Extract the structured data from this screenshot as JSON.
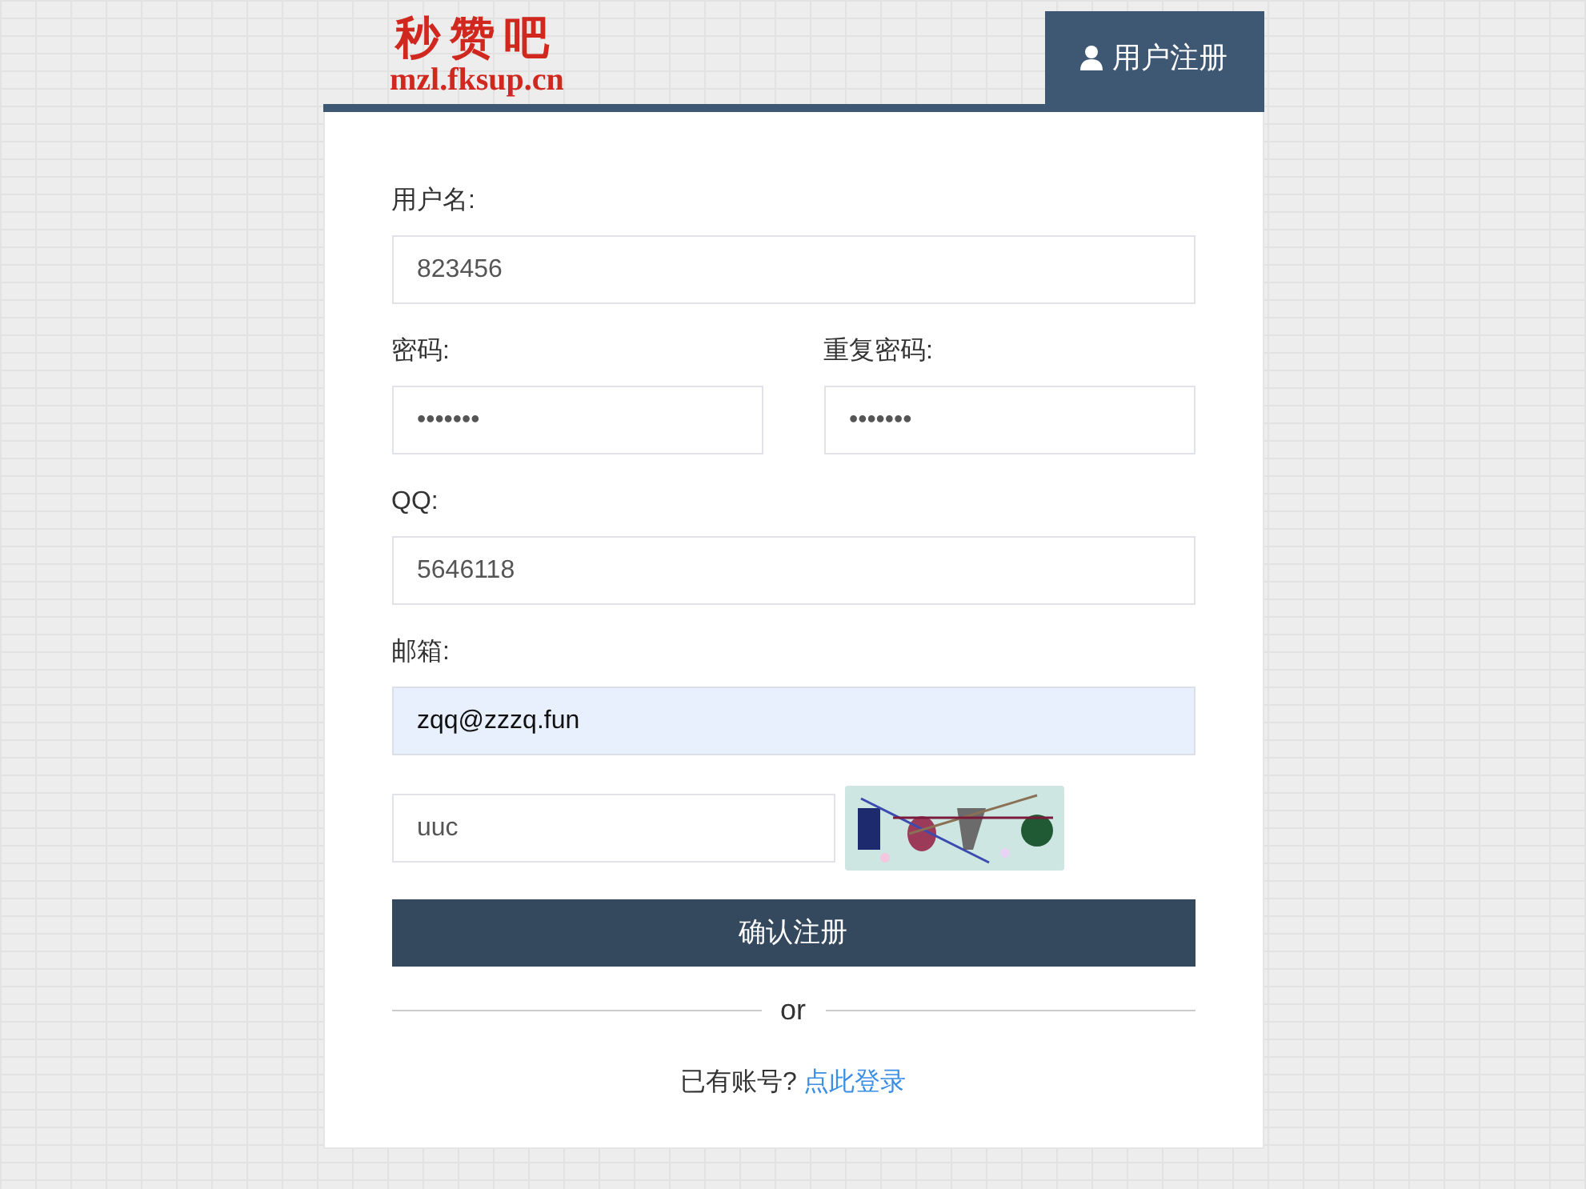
{
  "logo": {
    "title": "秒赞吧",
    "subtitle": "mzl.fksup.cn"
  },
  "tab": {
    "label": "用户注册",
    "selected": true
  },
  "form": {
    "username": {
      "label": "用户名:",
      "value": "823456"
    },
    "password": {
      "label": "密码:",
      "value": "•••••••"
    },
    "repeat_password": {
      "label": "重复密码:",
      "value": "•••••••"
    },
    "qq": {
      "label": "QQ:",
      "value": "5646118"
    },
    "email": {
      "label": "邮箱:",
      "value": "zqq@zzzq.fun",
      "autofilled": true
    },
    "captcha": {
      "value": "uuc"
    },
    "submit": "确认注册",
    "divider": "or",
    "login_prompt": "已有账号?",
    "login_link": "点此登录"
  }
}
